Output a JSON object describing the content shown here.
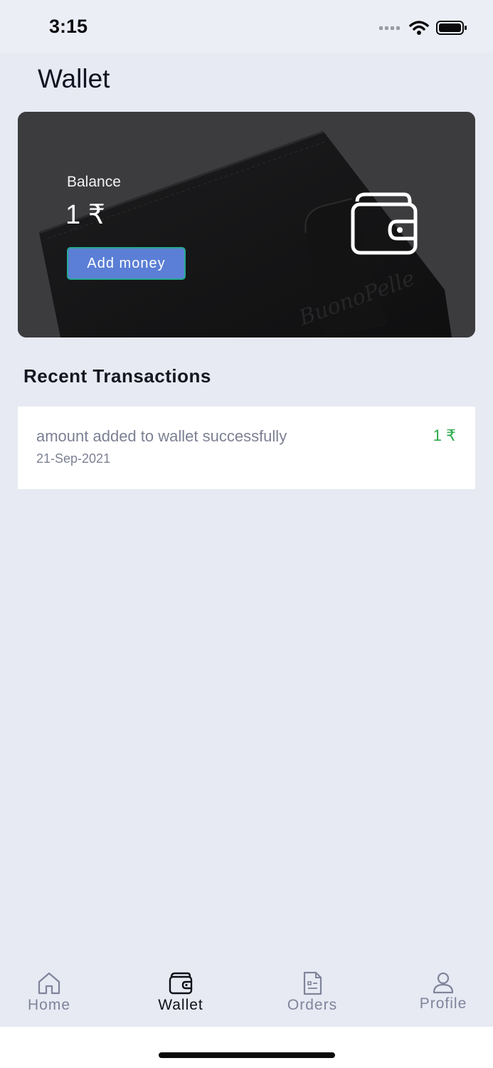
{
  "status_bar": {
    "time": "3:15"
  },
  "header": {
    "title": "Wallet"
  },
  "balance_card": {
    "label": "Balance",
    "amount": "1 ₹",
    "add_money_label": "Add money",
    "icon": "wallet-icon",
    "background": "black-leather-wallet-photo"
  },
  "recent": {
    "title": "Recent Transactions",
    "transactions": [
      {
        "description": "amount added to wallet successfully",
        "date": "21-Sep-2021",
        "amount": "1 ₹"
      }
    ]
  },
  "nav": {
    "items": [
      {
        "label": "Home",
        "icon": "home-icon",
        "active": false
      },
      {
        "label": "Wallet",
        "icon": "wallet-icon",
        "active": true
      },
      {
        "label": "Orders",
        "icon": "orders-document-icon",
        "active": false
      },
      {
        "label": "Profile",
        "icon": "profile-icon",
        "active": false
      }
    ]
  },
  "colors": {
    "background": "#e7e9f3",
    "accent_button": "#5b7fd6",
    "button_border": "#25a88f",
    "credit_amount": "#2ba84a",
    "muted_text": "#7c8093"
  }
}
